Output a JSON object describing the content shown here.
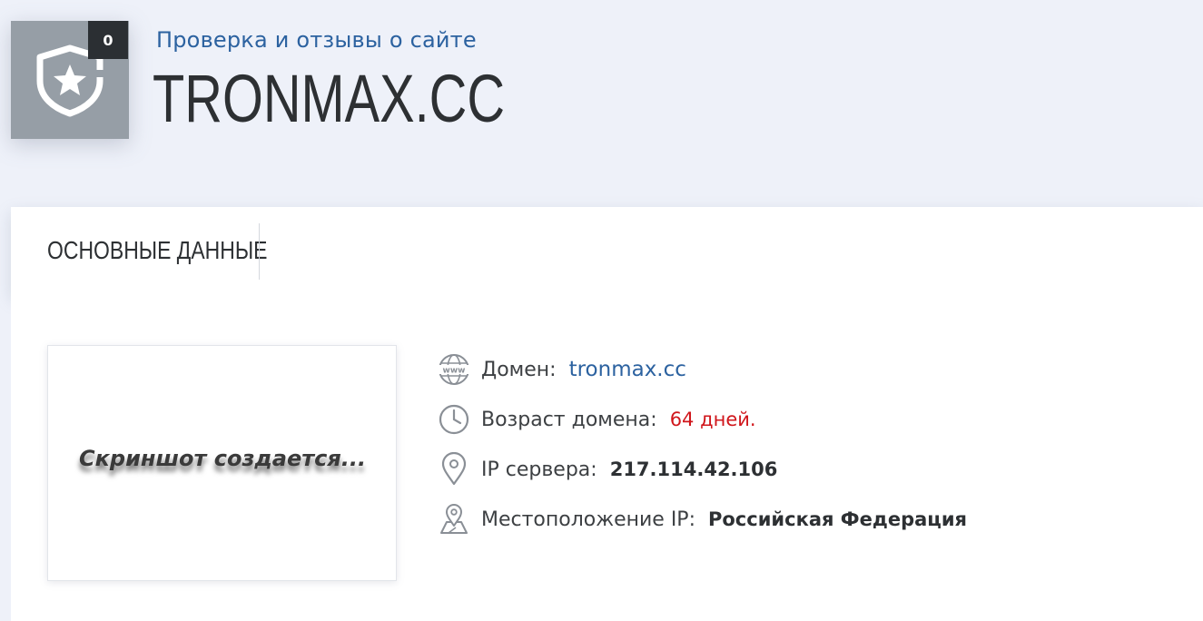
{
  "header": {
    "badge_count": "0",
    "subtitle": "Проверка и отзывы о сайте",
    "site_title": "TRONMAX.CC"
  },
  "tabs": [
    {
      "label": "ОСНОВНЫЕ ДАННЫЕ"
    }
  ],
  "screenshot": {
    "placeholder_text": "Скриншот создается..."
  },
  "info": {
    "domain": {
      "icon": "www-icon",
      "label": "Домен:",
      "value": "tronmax.cc"
    },
    "age": {
      "icon": "clock-icon",
      "label": "Возраст домена:",
      "value": "64 дней."
    },
    "ip": {
      "icon": "location-pin-icon",
      "label": "IP сервера:",
      "value": "217.114.42.106"
    },
    "location": {
      "icon": "map-pin-icon",
      "label": "Местоположение IP:",
      "value": "Российская Федерация"
    }
  },
  "colors": {
    "link": "#2c62a0",
    "warning": "#d0161b",
    "badge_bg": "#969ea6"
  }
}
